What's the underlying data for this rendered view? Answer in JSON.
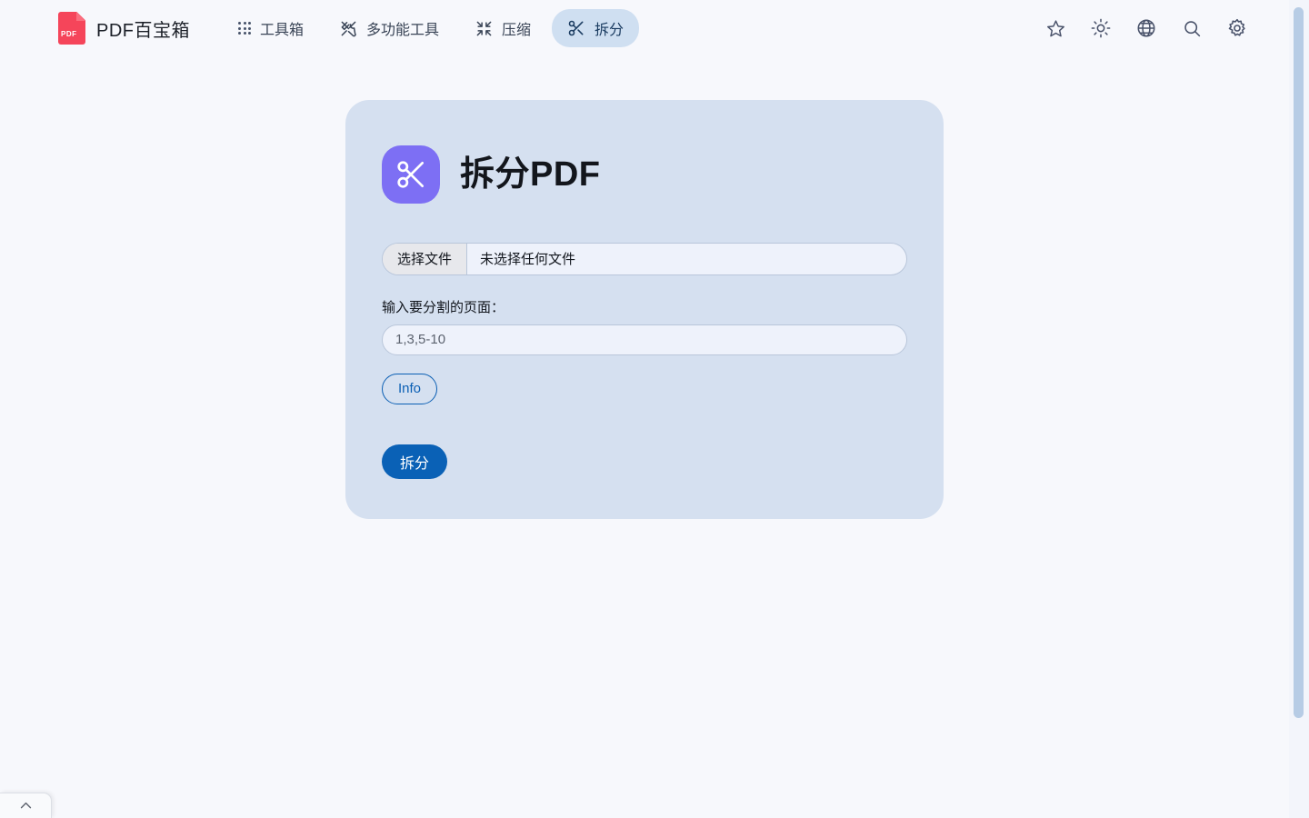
{
  "header": {
    "brand": {
      "logo_label": "PDF",
      "name": "PDF百宝箱"
    },
    "nav": [
      {
        "label": "工具箱",
        "icon": "grid-dots-icon",
        "active": false
      },
      {
        "label": "多功能工具",
        "icon": "tools-icon",
        "active": false
      },
      {
        "label": "压缩",
        "icon": "compress-icon",
        "active": false
      },
      {
        "label": "拆分",
        "icon": "scissors-icon",
        "active": true
      }
    ],
    "actions": [
      {
        "name": "favorite-icon",
        "title": "收藏"
      },
      {
        "name": "theme-sun-icon",
        "title": "主题"
      },
      {
        "name": "language-globe-icon",
        "title": "语言"
      },
      {
        "name": "search-icon",
        "title": "搜索"
      },
      {
        "name": "settings-gear-icon",
        "title": "设置"
      }
    ]
  },
  "card": {
    "icon": "scissors-icon",
    "title": "拆分PDF",
    "file_input": {
      "button_label": "选择文件",
      "status_text": "未选择任何文件"
    },
    "pages_field": {
      "label": "输入要分割的页面：",
      "value": "",
      "placeholder": "1,3,5-10"
    },
    "info_button": "Info",
    "submit_button": "拆分"
  },
  "bottom_tab": {
    "icon": "chevron-up-icon"
  },
  "colors": {
    "page_background": "#f7f8fc",
    "card_background": "#d5e0f0",
    "accent_blue": "#0a61b6",
    "active_pill": "#cfdff1",
    "tool_icon_purple": "#7d6ff4",
    "logo_red": "#f5455a",
    "scrollbar_thumb": "#b7cce5"
  }
}
